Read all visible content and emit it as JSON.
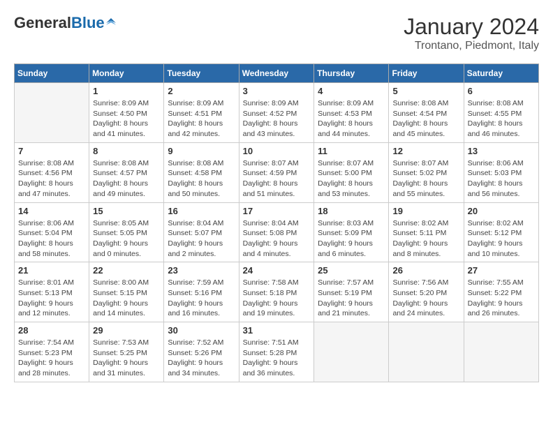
{
  "header": {
    "logo_general": "General",
    "logo_blue": "Blue",
    "month_title": "January 2024",
    "location": "Trontano, Piedmont, Italy"
  },
  "days_of_week": [
    "Sunday",
    "Monday",
    "Tuesday",
    "Wednesday",
    "Thursday",
    "Friday",
    "Saturday"
  ],
  "weeks": [
    [
      {
        "day": "",
        "info": ""
      },
      {
        "day": "1",
        "info": "Sunrise: 8:09 AM\nSunset: 4:50 PM\nDaylight: 8 hours\nand 41 minutes."
      },
      {
        "day": "2",
        "info": "Sunrise: 8:09 AM\nSunset: 4:51 PM\nDaylight: 8 hours\nand 42 minutes."
      },
      {
        "day": "3",
        "info": "Sunrise: 8:09 AM\nSunset: 4:52 PM\nDaylight: 8 hours\nand 43 minutes."
      },
      {
        "day": "4",
        "info": "Sunrise: 8:09 AM\nSunset: 4:53 PM\nDaylight: 8 hours\nand 44 minutes."
      },
      {
        "day": "5",
        "info": "Sunrise: 8:08 AM\nSunset: 4:54 PM\nDaylight: 8 hours\nand 45 minutes."
      },
      {
        "day": "6",
        "info": "Sunrise: 8:08 AM\nSunset: 4:55 PM\nDaylight: 8 hours\nand 46 minutes."
      }
    ],
    [
      {
        "day": "7",
        "info": "Sunrise: 8:08 AM\nSunset: 4:56 PM\nDaylight: 8 hours\nand 47 minutes."
      },
      {
        "day": "8",
        "info": "Sunrise: 8:08 AM\nSunset: 4:57 PM\nDaylight: 8 hours\nand 49 minutes."
      },
      {
        "day": "9",
        "info": "Sunrise: 8:08 AM\nSunset: 4:58 PM\nDaylight: 8 hours\nand 50 minutes."
      },
      {
        "day": "10",
        "info": "Sunrise: 8:07 AM\nSunset: 4:59 PM\nDaylight: 8 hours\nand 51 minutes."
      },
      {
        "day": "11",
        "info": "Sunrise: 8:07 AM\nSunset: 5:00 PM\nDaylight: 8 hours\nand 53 minutes."
      },
      {
        "day": "12",
        "info": "Sunrise: 8:07 AM\nSunset: 5:02 PM\nDaylight: 8 hours\nand 55 minutes."
      },
      {
        "day": "13",
        "info": "Sunrise: 8:06 AM\nSunset: 5:03 PM\nDaylight: 8 hours\nand 56 minutes."
      }
    ],
    [
      {
        "day": "14",
        "info": "Sunrise: 8:06 AM\nSunset: 5:04 PM\nDaylight: 8 hours\nand 58 minutes."
      },
      {
        "day": "15",
        "info": "Sunrise: 8:05 AM\nSunset: 5:05 PM\nDaylight: 9 hours\nand 0 minutes."
      },
      {
        "day": "16",
        "info": "Sunrise: 8:04 AM\nSunset: 5:07 PM\nDaylight: 9 hours\nand 2 minutes."
      },
      {
        "day": "17",
        "info": "Sunrise: 8:04 AM\nSunset: 5:08 PM\nDaylight: 9 hours\nand 4 minutes."
      },
      {
        "day": "18",
        "info": "Sunrise: 8:03 AM\nSunset: 5:09 PM\nDaylight: 9 hours\nand 6 minutes."
      },
      {
        "day": "19",
        "info": "Sunrise: 8:02 AM\nSunset: 5:11 PM\nDaylight: 9 hours\nand 8 minutes."
      },
      {
        "day": "20",
        "info": "Sunrise: 8:02 AM\nSunset: 5:12 PM\nDaylight: 9 hours\nand 10 minutes."
      }
    ],
    [
      {
        "day": "21",
        "info": "Sunrise: 8:01 AM\nSunset: 5:13 PM\nDaylight: 9 hours\nand 12 minutes."
      },
      {
        "day": "22",
        "info": "Sunrise: 8:00 AM\nSunset: 5:15 PM\nDaylight: 9 hours\nand 14 minutes."
      },
      {
        "day": "23",
        "info": "Sunrise: 7:59 AM\nSunset: 5:16 PM\nDaylight: 9 hours\nand 16 minutes."
      },
      {
        "day": "24",
        "info": "Sunrise: 7:58 AM\nSunset: 5:18 PM\nDaylight: 9 hours\nand 19 minutes."
      },
      {
        "day": "25",
        "info": "Sunrise: 7:57 AM\nSunset: 5:19 PM\nDaylight: 9 hours\nand 21 minutes."
      },
      {
        "day": "26",
        "info": "Sunrise: 7:56 AM\nSunset: 5:20 PM\nDaylight: 9 hours\nand 24 minutes."
      },
      {
        "day": "27",
        "info": "Sunrise: 7:55 AM\nSunset: 5:22 PM\nDaylight: 9 hours\nand 26 minutes."
      }
    ],
    [
      {
        "day": "28",
        "info": "Sunrise: 7:54 AM\nSunset: 5:23 PM\nDaylight: 9 hours\nand 28 minutes."
      },
      {
        "day": "29",
        "info": "Sunrise: 7:53 AM\nSunset: 5:25 PM\nDaylight: 9 hours\nand 31 minutes."
      },
      {
        "day": "30",
        "info": "Sunrise: 7:52 AM\nSunset: 5:26 PM\nDaylight: 9 hours\nand 34 minutes."
      },
      {
        "day": "31",
        "info": "Sunrise: 7:51 AM\nSunset: 5:28 PM\nDaylight: 9 hours\nand 36 minutes."
      },
      {
        "day": "",
        "info": ""
      },
      {
        "day": "",
        "info": ""
      },
      {
        "day": "",
        "info": ""
      }
    ]
  ]
}
